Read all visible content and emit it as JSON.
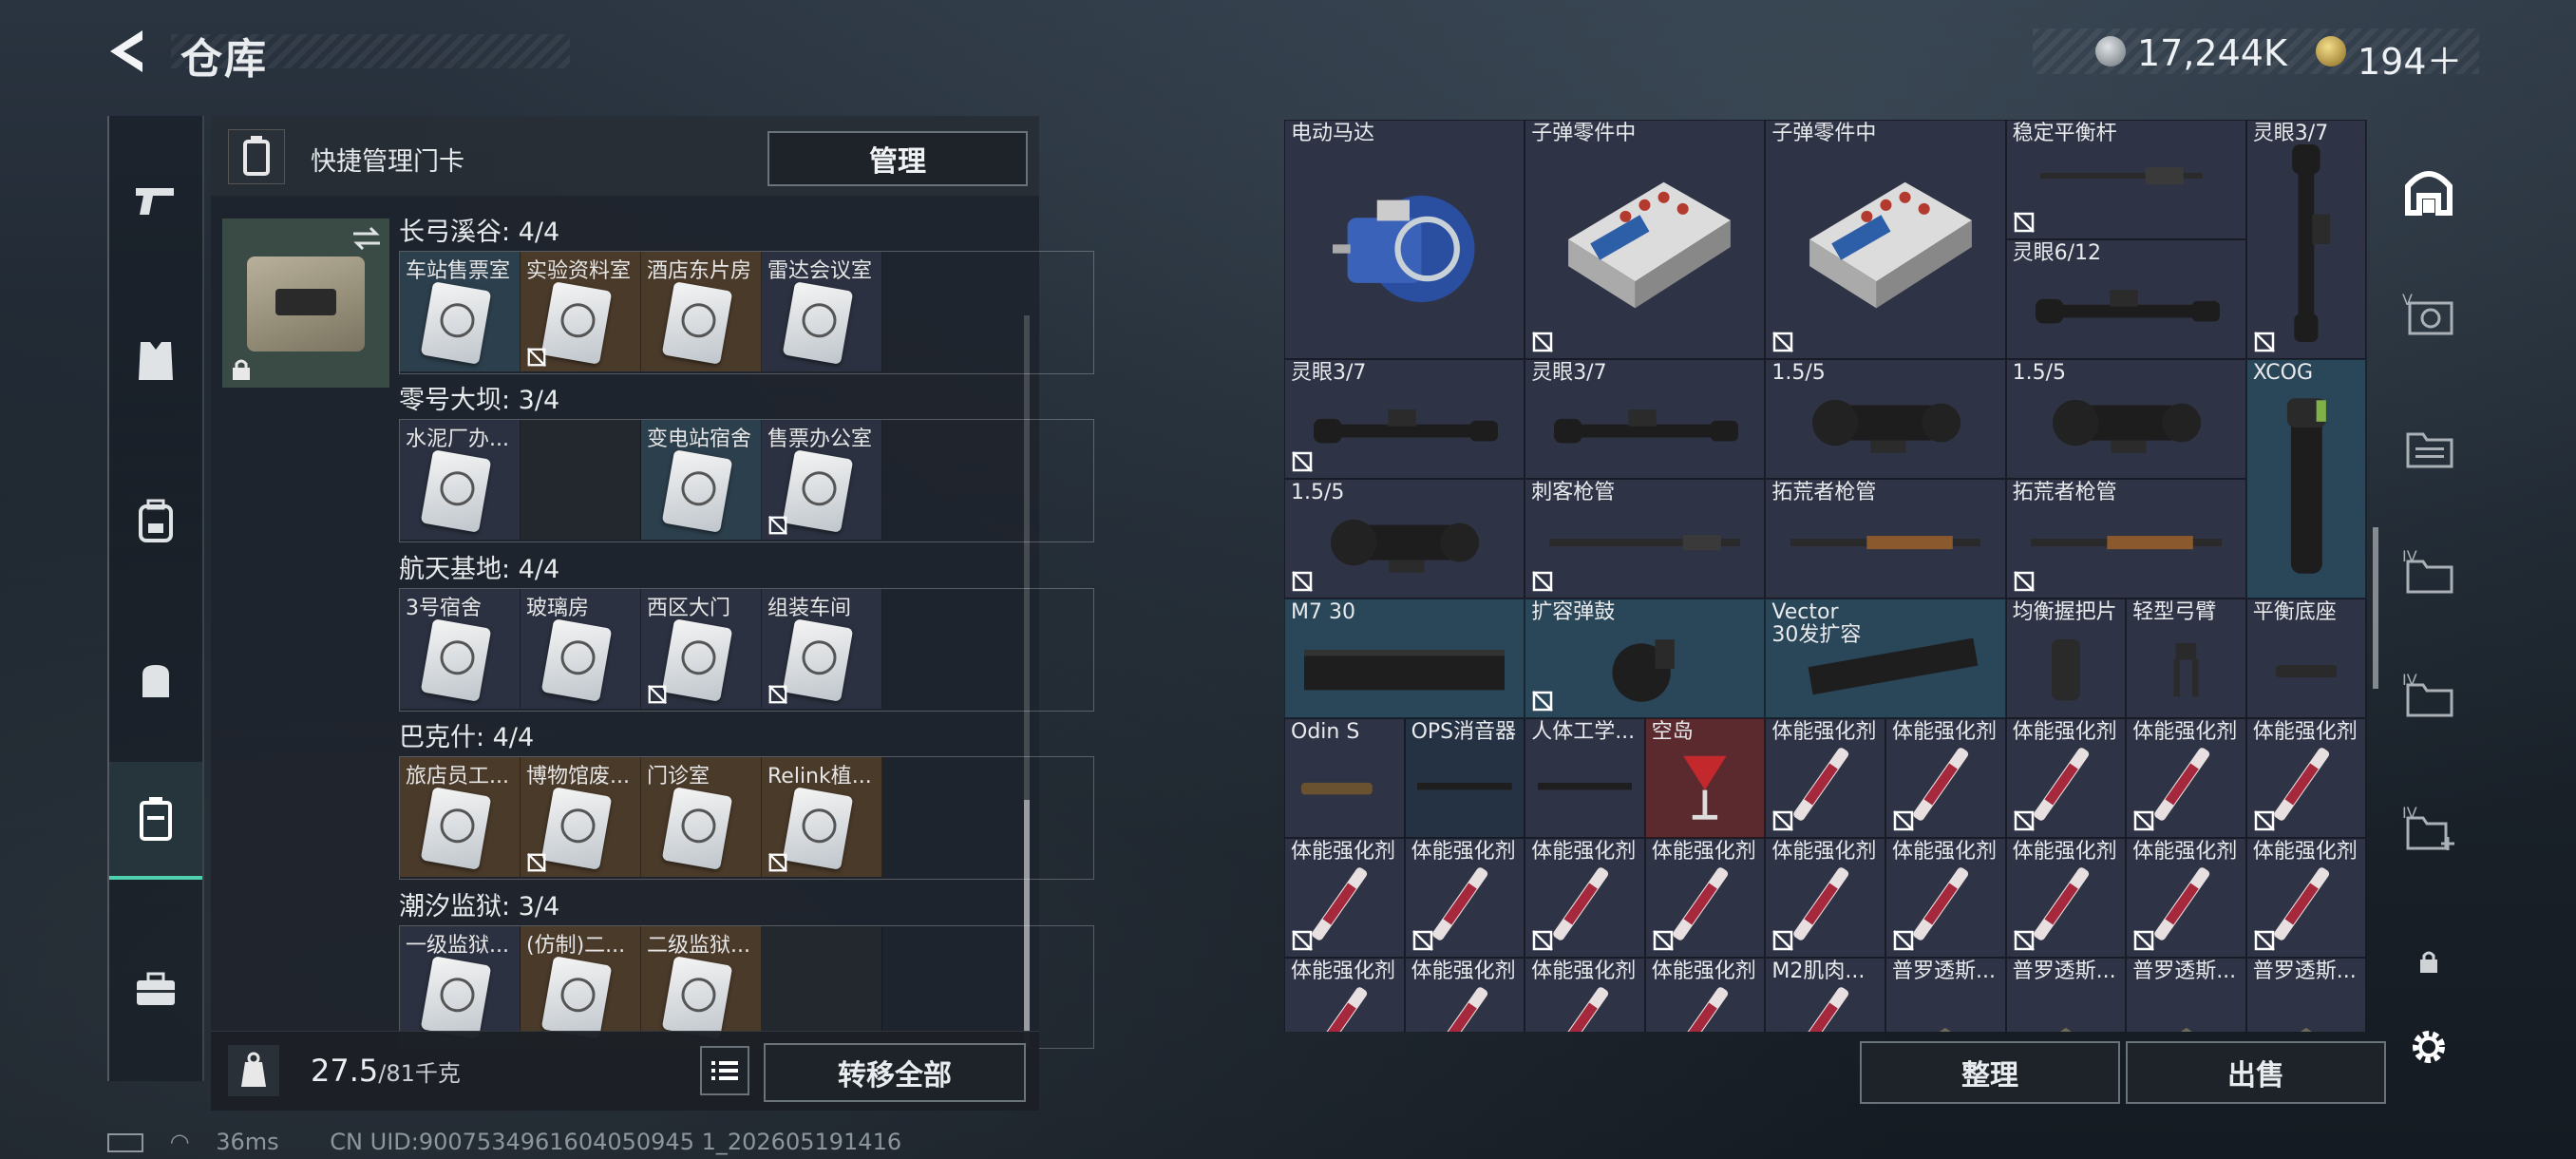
{
  "header": {
    "title": "仓库",
    "currency_silver": "17,244K",
    "currency_gold": "194＋"
  },
  "left_nav": {
    "items": [
      "weapons-icon",
      "armor-icon",
      "backpack-icon",
      "bag-icon",
      "keycard-icon",
      "toolbox-icon"
    ],
    "active_index": 4
  },
  "keycard_panel": {
    "title": "快捷管理门卡",
    "manage_label": "管理",
    "regions": [
      {
        "title": "长弓溪谷: 4/4",
        "cards": [
          {
            "label": "车站售票室",
            "bg": "blue",
            "locked": false
          },
          {
            "label": "实验资料室",
            "bg": "brown",
            "locked": true
          },
          {
            "label": "酒店东片房",
            "bg": "brown",
            "locked": false
          },
          {
            "label": "雷达会议室",
            "bg": "navy",
            "locked": false
          }
        ]
      },
      {
        "title": "零号大坝: 3/4",
        "cards": [
          {
            "label": "水泥厂办...",
            "bg": "navy",
            "locked": false
          },
          {
            "label": "",
            "bg": "dark",
            "locked": false
          },
          {
            "label": "变电站宿舍",
            "bg": "blue",
            "locked": false
          },
          {
            "label": "售票办公室",
            "bg": "navy",
            "locked": true
          }
        ]
      },
      {
        "title": "航天基地: 4/4",
        "cards": [
          {
            "label": "3号宿舍",
            "bg": "navy",
            "locked": false
          },
          {
            "label": "玻璃房",
            "bg": "navy",
            "locked": false
          },
          {
            "label": "西区大门",
            "bg": "navy",
            "locked": true
          },
          {
            "label": "组装车间",
            "bg": "navy",
            "locked": true
          }
        ]
      },
      {
        "title": "巴克什: 4/4",
        "cards": [
          {
            "label": "旅店员工...",
            "bg": "brown",
            "locked": false
          },
          {
            "label": "博物馆废...",
            "bg": "brown",
            "locked": true
          },
          {
            "label": "门诊室",
            "bg": "brown",
            "locked": false
          },
          {
            "label": "Relink植...",
            "bg": "brown",
            "locked": true
          }
        ]
      },
      {
        "title": "潮汐监狱: 3/4",
        "cards": [
          {
            "label": "一级监狱...",
            "bg": "navy",
            "locked": false
          },
          {
            "label": "(仿制)二...",
            "bg": "brown",
            "locked": false
          },
          {
            "label": "二级监狱...",
            "bg": "brown",
            "locked": false
          },
          {
            "label": "",
            "bg": "dark",
            "locked": false
          }
        ]
      }
    ],
    "weight_value": "27.5",
    "weight_capacity": "/81千克",
    "transfer_label": "转移全部"
  },
  "inventory": {
    "items": [
      {
        "label": "电动马达",
        "art": "motor",
        "bg": "purple",
        "locked": false,
        "c": 0,
        "r": 0,
        "w": 2,
        "h": 2
      },
      {
        "label": "子弹零件中",
        "art": "ammo-box",
        "bg": "purple",
        "locked": true,
        "c": 2,
        "r": 0,
        "w": 2,
        "h": 2
      },
      {
        "label": "子弹零件中",
        "art": "ammo-box",
        "bg": "purple",
        "locked": true,
        "c": 4,
        "r": 0,
        "w": 2,
        "h": 2
      },
      {
        "label": "稳定平衡杆",
        "art": "stabilizer",
        "bg": "purple",
        "locked": true,
        "c": 6,
        "r": 0,
        "w": 2,
        "h": 1
      },
      {
        "label": "灵眼3/7",
        "art": "scope-v",
        "bg": "purple",
        "locked": true,
        "c": 8,
        "r": 0,
        "w": 1,
        "h": 2
      },
      {
        "label": "灵眼6/12",
        "art": "scope",
        "bg": "purple",
        "locked": false,
        "c": 6,
        "r": 1,
        "w": 2,
        "h": 1
      },
      {
        "label": "灵眼3/7",
        "art": "scope",
        "bg": "purple",
        "locked": true,
        "c": 0,
        "r": 2,
        "w": 2,
        "h": 1
      },
      {
        "label": "灵眼3/7",
        "art": "scope",
        "bg": "purple",
        "locked": false,
        "c": 2,
        "r": 2,
        "w": 2,
        "h": 1
      },
      {
        "label": "1.5/5",
        "art": "scope-big",
        "bg": "purple",
        "locked": false,
        "c": 4,
        "r": 2,
        "w": 2,
        "h": 1
      },
      {
        "label": "1.5/5",
        "art": "scope-big",
        "bg": "purple",
        "locked": false,
        "c": 6,
        "r": 2,
        "w": 2,
        "h": 1
      },
      {
        "label": "XCOG",
        "art": "xcog",
        "bg": "blue",
        "locked": false,
        "c": 8,
        "r": 2,
        "w": 1,
        "h": 2
      },
      {
        "label": "1.5/5",
        "art": "scope-big",
        "bg": "purple",
        "locked": true,
        "c": 0,
        "r": 3,
        "w": 2,
        "h": 1
      },
      {
        "label": "刺客枪管",
        "art": "barrel",
        "bg": "purple",
        "locked": true,
        "c": 2,
        "r": 3,
        "w": 2,
        "h": 1
      },
      {
        "label": "拓荒者枪管",
        "art": "barrel-wood",
        "bg": "purple",
        "locked": false,
        "c": 4,
        "r": 3,
        "w": 2,
        "h": 1
      },
      {
        "label": "拓荒者枪管",
        "art": "barrel-wood",
        "bg": "purple",
        "locked": true,
        "c": 6,
        "r": 3,
        "w": 2,
        "h": 1
      },
      {
        "label": "M7 30",
        "art": "mag",
        "bg": "blue",
        "locked": false,
        "c": 0,
        "r": 4,
        "w": 2,
        "h": 1
      },
      {
        "label": "扩容弹鼓",
        "art": "drum",
        "bg": "blue",
        "locked": true,
        "c": 2,
        "r": 4,
        "w": 2,
        "h": 1
      },
      {
        "label": "Vector\n30发扩容",
        "art": "mag2",
        "bg": "blue",
        "locked": false,
        "c": 4,
        "r": 4,
        "w": 2,
        "h": 1
      },
      {
        "label": "均衡握把片",
        "art": "grip",
        "bg": "purple",
        "locked": false,
        "c": 6,
        "r": 4,
        "w": 1,
        "h": 1
      },
      {
        "label": "轻型弓臂",
        "art": "bipod",
        "bg": "purple",
        "locked": false,
        "c": 7,
        "r": 4,
        "w": 1,
        "h": 1
      },
      {
        "label": "平衡底座",
        "art": "base",
        "bg": "purple",
        "locked": false,
        "c": 8,
        "r": 4,
        "w": 1,
        "h": 1
      },
      {
        "label": "Odin S",
        "art": "small",
        "bg": "purple",
        "locked": false,
        "c": 0,
        "r": 5,
        "w": 1,
        "h": 1
      },
      {
        "label": "OPS消音器",
        "art": "rail",
        "bg": "navy",
        "locked": false,
        "c": 1,
        "r": 5,
        "w": 1,
        "h": 1
      },
      {
        "label": "人体工学...",
        "art": "rail",
        "bg": "purple",
        "locked": false,
        "c": 2,
        "r": 5,
        "w": 1,
        "h": 1
      },
      {
        "label": "空岛",
        "art": "cocktail",
        "bg": "red",
        "locked": false,
        "c": 3,
        "r": 5,
        "w": 1,
        "h": 1
      },
      {
        "label": "体能强化剂",
        "art": "syringe",
        "bg": "purple",
        "locked": true,
        "c": 4,
        "r": 5,
        "w": 1,
        "h": 1
      },
      {
        "label": "体能强化剂",
        "art": "syringe",
        "bg": "purple",
        "locked": true,
        "c": 5,
        "r": 5,
        "w": 1,
        "h": 1
      },
      {
        "label": "体能强化剂",
        "art": "syringe",
        "bg": "purple",
        "locked": true,
        "c": 6,
        "r": 5,
        "w": 1,
        "h": 1
      },
      {
        "label": "体能强化剂",
        "art": "syringe",
        "bg": "purple",
        "locked": true,
        "c": 7,
        "r": 5,
        "w": 1,
        "h": 1
      },
      {
        "label": "体能强化剂",
        "art": "syringe",
        "bg": "purple",
        "locked": true,
        "c": 8,
        "r": 5,
        "w": 1,
        "h": 1
      },
      {
        "label": "体能强化剂",
        "art": "syringe",
        "bg": "purple",
        "locked": true,
        "c": 0,
        "r": 6,
        "w": 1,
        "h": 1
      },
      {
        "label": "体能强化剂",
        "art": "syringe",
        "bg": "purple",
        "locked": true,
        "c": 1,
        "r": 6,
        "w": 1,
        "h": 1
      },
      {
        "label": "体能强化剂",
        "art": "syringe",
        "bg": "purple",
        "locked": true,
        "c": 2,
        "r": 6,
        "w": 1,
        "h": 1
      },
      {
        "label": "体能强化剂",
        "art": "syringe",
        "bg": "purple",
        "locked": true,
        "c": 3,
        "r": 6,
        "w": 1,
        "h": 1
      },
      {
        "label": "体能强化剂",
        "art": "syringe",
        "bg": "purple",
        "locked": true,
        "c": 4,
        "r": 6,
        "w": 1,
        "h": 1
      },
      {
        "label": "体能强化剂",
        "art": "syringe",
        "bg": "purple",
        "locked": true,
        "c": 5,
        "r": 6,
        "w": 1,
        "h": 1
      },
      {
        "label": "体能强化剂",
        "art": "syringe",
        "bg": "purple",
        "locked": true,
        "c": 6,
        "r": 6,
        "w": 1,
        "h": 1
      },
      {
        "label": "体能强化剂",
        "art": "syringe",
        "bg": "purple",
        "locked": true,
        "c": 7,
        "r": 6,
        "w": 1,
        "h": 1
      },
      {
        "label": "体能强化剂",
        "art": "syringe",
        "bg": "purple",
        "locked": true,
        "c": 8,
        "r": 6,
        "w": 1,
        "h": 1
      },
      {
        "label": "体能强化剂",
        "art": "syringe",
        "bg": "purple",
        "locked": false,
        "c": 0,
        "r": 7,
        "w": 1,
        "h": 1
      },
      {
        "label": "体能强化剂",
        "art": "syringe",
        "bg": "purple",
        "locked": false,
        "c": 1,
        "r": 7,
        "w": 1,
        "h": 1
      },
      {
        "label": "体能强化剂",
        "art": "syringe",
        "bg": "purple",
        "locked": false,
        "c": 2,
        "r": 7,
        "w": 1,
        "h": 1
      },
      {
        "label": "体能强化剂",
        "art": "syringe",
        "bg": "purple",
        "locked": false,
        "c": 3,
        "r": 7,
        "w": 1,
        "h": 1
      },
      {
        "label": "M2肌肉...",
        "art": "syringe",
        "bg": "purple",
        "locked": false,
        "c": 4,
        "r": 7,
        "w": 1,
        "h": 1
      },
      {
        "label": "普罗透斯...",
        "art": "pouch",
        "bg": "purple",
        "locked": false,
        "c": 5,
        "r": 7,
        "w": 1,
        "h": 1
      },
      {
        "label": "普罗透斯...",
        "art": "pouch",
        "bg": "purple",
        "locked": false,
        "c": 6,
        "r": 7,
        "w": 1,
        "h": 1
      },
      {
        "label": "普罗透斯...",
        "art": "pouch",
        "bg": "purple",
        "locked": false,
        "c": 7,
        "r": 7,
        "w": 1,
        "h": 1
      },
      {
        "label": "普罗透斯...",
        "art": "pouch",
        "bg": "purple",
        "locked": false,
        "c": 8,
        "r": 7,
        "w": 1,
        "h": 1
      }
    ],
    "sort_label": "整理",
    "sell_label": "出售"
  },
  "right_nav": {
    "items": [
      "storage-home-icon",
      "vault-v-icon",
      "folder-icon",
      "folder-iv-icon",
      "folder-iv-icon",
      "folder-add-icon",
      "lock-icon",
      "settings-icon"
    ]
  },
  "status": {
    "ping": "36ms",
    "uid": "CN UID:9007534961604050945 1_202605191416"
  },
  "colors": {
    "accent": "#4fd1b0",
    "bg_purple": "#2f3346",
    "bg_blue": "#2a4659",
    "bg_red": "#5a2a2f"
  }
}
